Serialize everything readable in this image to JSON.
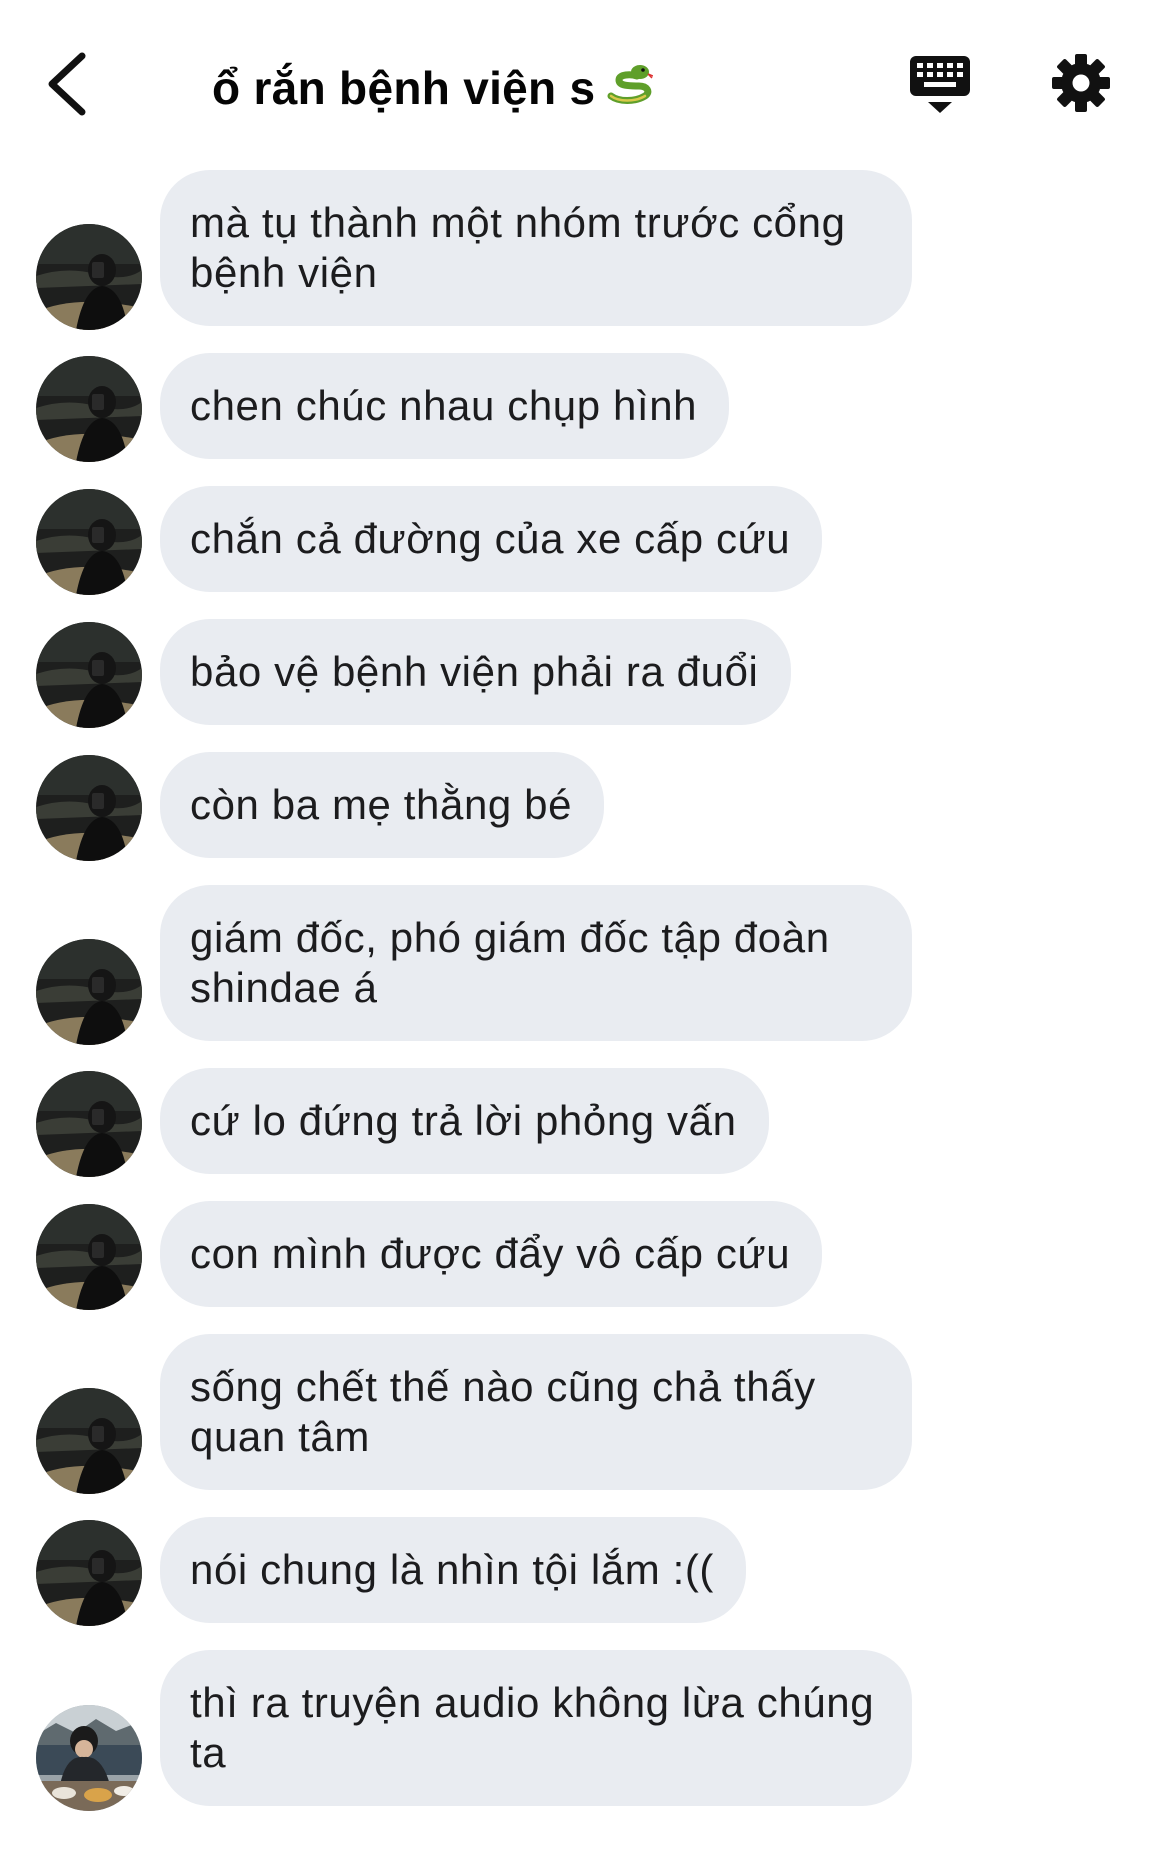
{
  "header": {
    "title": "ổ rắn bệnh viện s",
    "title_emoji": "snake-emoji",
    "back_icon": "chevron-left-icon",
    "keyboard_icon": "keyboard-icon",
    "settings_icon": "gear-icon"
  },
  "colors": {
    "bubble_bg": "#e9ecf1",
    "text": "#1c1c1e",
    "background": "#ffffff"
  },
  "messages": [
    {
      "text": "mà tụ thành một nhóm trước cổng bệnh viện",
      "avatar": "avatar-photo-dark"
    },
    {
      "text": "chen chúc nhau chụp hình",
      "avatar": "avatar-photo-dark"
    },
    {
      "text": "chắn cả đường của xe cấp cứu",
      "avatar": "avatar-photo-dark"
    },
    {
      "text": "bảo vệ bệnh viện phải ra đuổi",
      "avatar": "avatar-photo-dark"
    },
    {
      "text": "còn ba mẹ thằng bé",
      "avatar": "avatar-photo-dark"
    },
    {
      "text": "giám đốc, phó giám đốc tập đoàn shindae á",
      "avatar": "avatar-photo-dark"
    },
    {
      "text": "cứ lo đứng trả lời phỏng vấn",
      "avatar": "avatar-photo-dark"
    },
    {
      "text": "con mình được đẩy vô cấp cứu",
      "avatar": "avatar-photo-dark"
    },
    {
      "text": "sống chết thế nào cũng chả thấy quan tâm",
      "avatar": "avatar-photo-dark"
    },
    {
      "text": "nói chung là nhìn tội lắm :((",
      "avatar": "avatar-photo-dark"
    },
    {
      "text": "thì ra truyện audio không lừa chúng ta",
      "avatar": "avatar-photo-eating"
    }
  ]
}
